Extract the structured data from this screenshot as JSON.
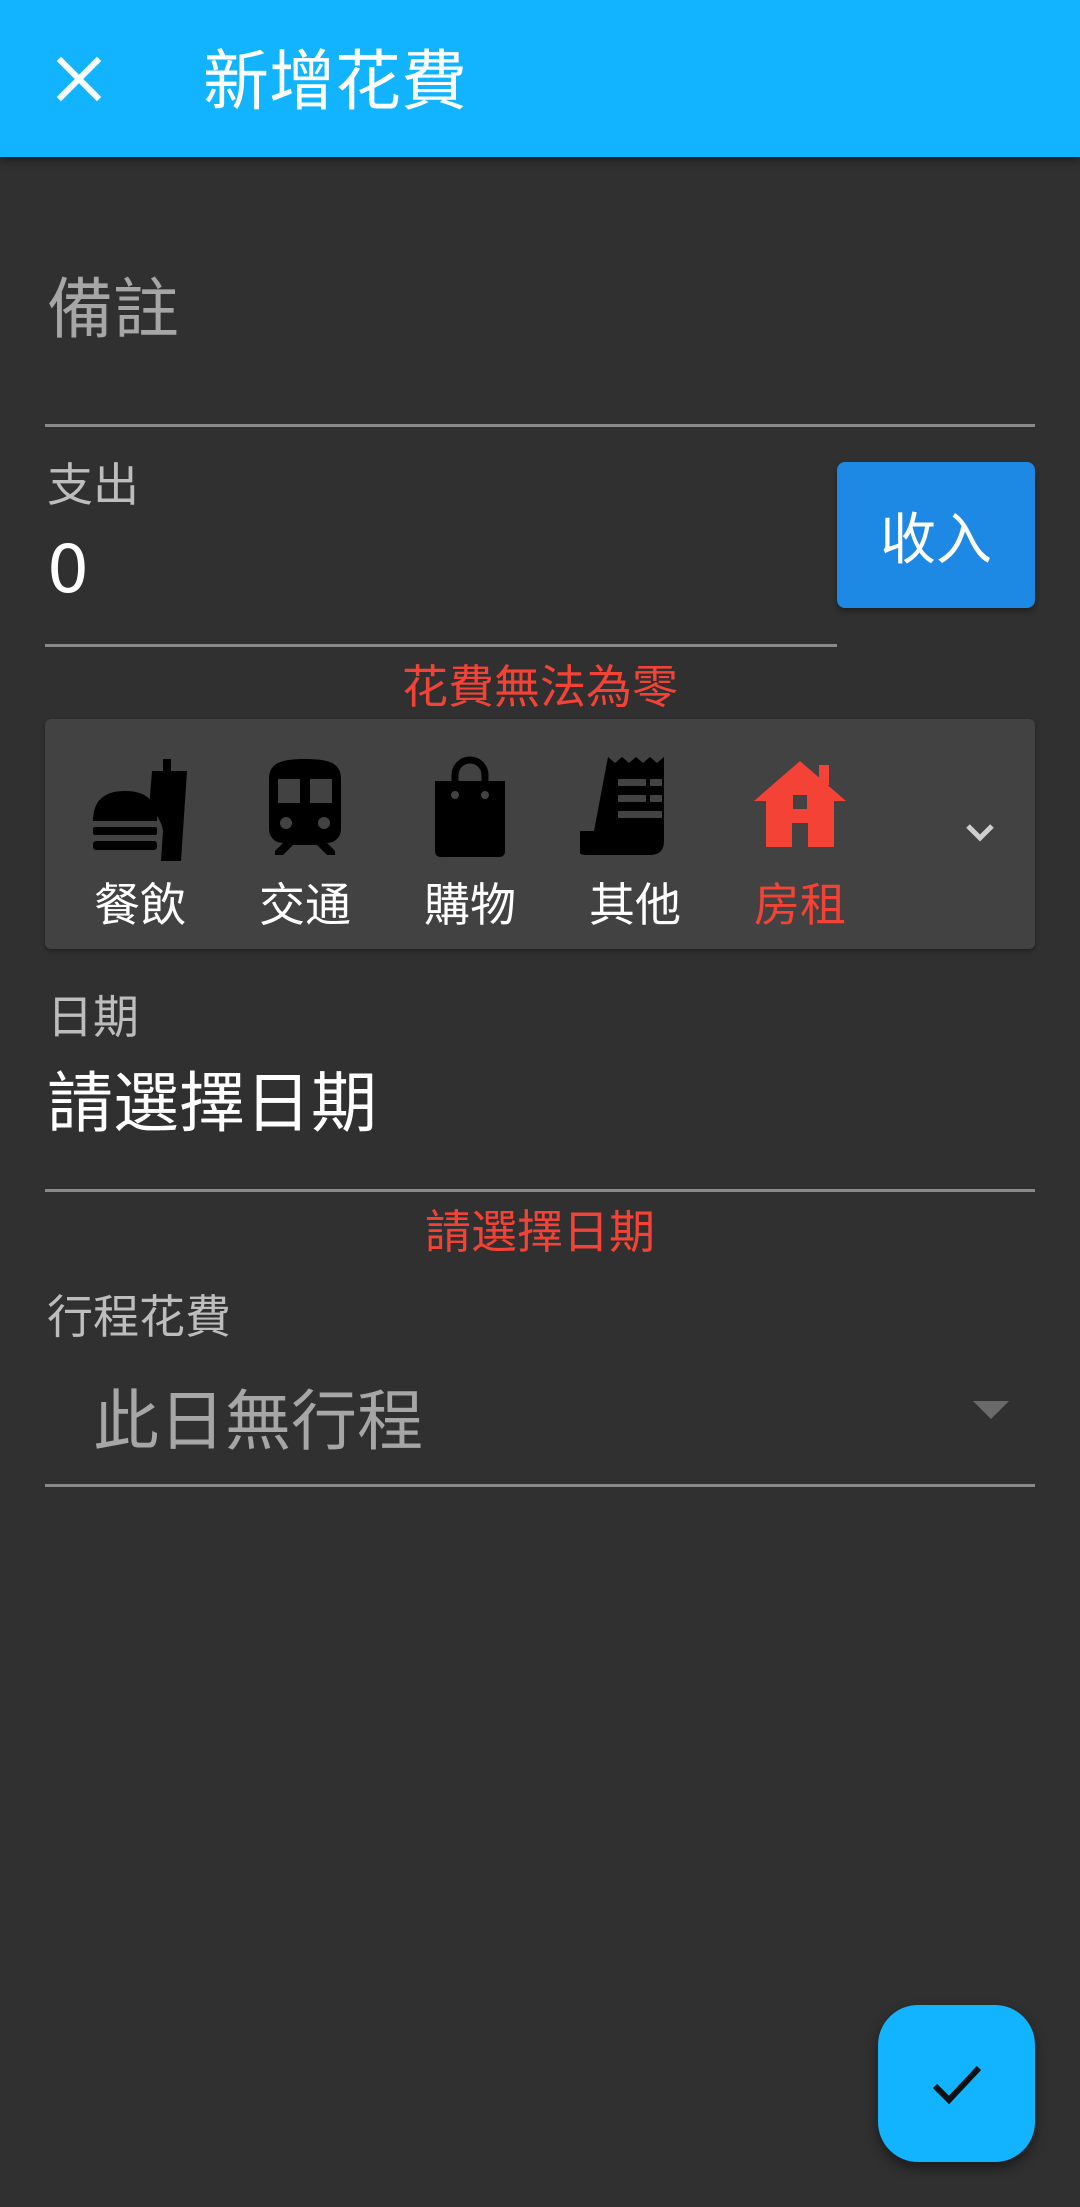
{
  "appbar": {
    "title": "新增花費",
    "close_icon": "close-icon",
    "background": "#13b4ff"
  },
  "note": {
    "placeholder": "備註"
  },
  "amount": {
    "label": "支出",
    "value": "0",
    "toggle_label": "收入",
    "error": "花費無法為零"
  },
  "categories": {
    "items": [
      {
        "label": "餐飲",
        "icon": "fastfood-icon",
        "selected": false
      },
      {
        "label": "交通",
        "icon": "train-icon",
        "selected": false
      },
      {
        "label": "購物",
        "icon": "shopping-bag-icon",
        "selected": false
      },
      {
        "label": "其他",
        "icon": "receipt-icon",
        "selected": false
      },
      {
        "label": "房租",
        "icon": "house-icon",
        "selected": true
      }
    ],
    "expand_icon": "chevron-down-icon"
  },
  "date": {
    "label": "日期",
    "value": "請選擇日期",
    "error": "請選擇日期"
  },
  "trip": {
    "label": "行程花費",
    "value": "此日無行程",
    "dropdown_icon": "dropdown-arrow-icon"
  },
  "fab": {
    "icon": "check-icon"
  },
  "colors": {
    "accent": "#13b4ff",
    "error": "#f44336",
    "button": "#1e88e5",
    "background": "#303030"
  }
}
